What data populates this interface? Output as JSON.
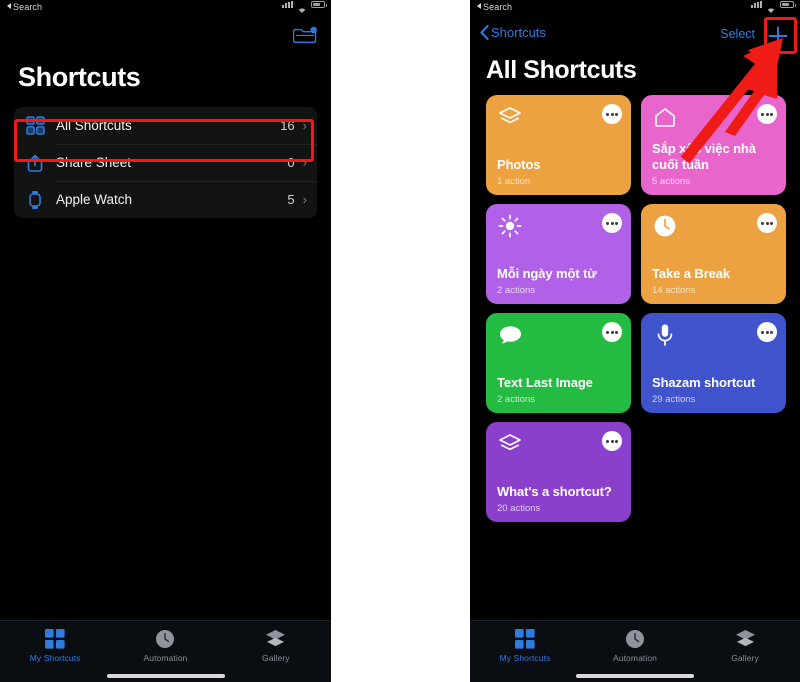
{
  "status_bar": {
    "back_label": "Search",
    "icons": [
      "signal-icon",
      "wifi-icon",
      "battery-icon"
    ]
  },
  "left_panel": {
    "nav": {
      "folder_icon": "folder-badge-icon"
    },
    "title": "Shortcuts",
    "list": [
      {
        "icon": "grid-squares-icon",
        "label": "All Shortcuts",
        "count": "16",
        "chevron": "›",
        "highlighted": true
      },
      {
        "icon": "share-sheet-icon",
        "label": "Share Sheet",
        "count": "0",
        "chevron": "›",
        "highlighted": false
      },
      {
        "icon": "apple-watch-icon",
        "label": "Apple Watch",
        "count": "5",
        "chevron": "›",
        "highlighted": false
      }
    ]
  },
  "right_panel": {
    "nav": {
      "back_label": "Shortcuts",
      "select_label": "Select",
      "add_label": "+"
    },
    "title": "All Shortcuts",
    "cards": [
      {
        "title": "Photos",
        "subtitle": "1 action",
        "color": "#eda242",
        "icon": "layers-icon"
      },
      {
        "title": "Sắp xếp việc nhà cuối tuần",
        "subtitle": "5 actions",
        "color": "#e865cb",
        "icon": "house-icon"
      },
      {
        "title": "Mỗi ngày một từ",
        "subtitle": "2 actions",
        "color": "#b061e8",
        "icon": "sun-icon"
      },
      {
        "title": "Take a Break",
        "subtitle": "14 actions",
        "color": "#eda242",
        "icon": "clock-icon"
      },
      {
        "title": "Text Last Image",
        "subtitle": "2 actions",
        "color": "#24bb43",
        "icon": "message-bubble-icon"
      },
      {
        "title": "Shazam shortcut",
        "subtitle": "29 actions",
        "color": "#3f54cc",
        "icon": "microphone-icon"
      },
      {
        "title": "What's a shortcut?",
        "subtitle": "20 actions",
        "color": "#8b40cc",
        "icon": "layers-icon"
      }
    ]
  },
  "tab_bar": {
    "items": [
      {
        "label": "My Shortcuts",
        "icon": "grid-squares-icon",
        "active": true
      },
      {
        "label": "Automation",
        "icon": "clock-icon",
        "active": false
      },
      {
        "label": "Gallery",
        "icon": "layers-icon",
        "active": false
      }
    ]
  },
  "annotations": {
    "highlight_color": "#ee1b16",
    "boxes": [
      "all-shortcuts-row",
      "add-shortcut-button"
    ],
    "arrow": "arrow-pointing-to-add-button"
  }
}
